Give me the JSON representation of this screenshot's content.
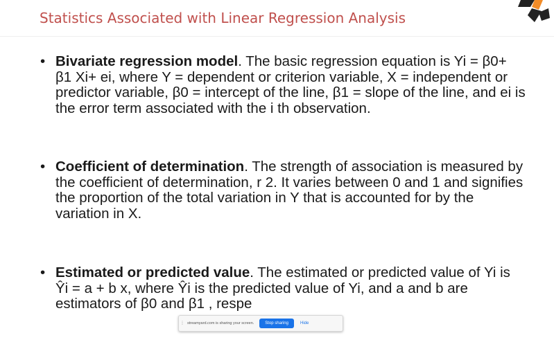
{
  "slide": {
    "title": "Statistics Associated with Linear Regression Analysis",
    "bullets": [
      {
        "heading": "Bivariate regression model",
        "body": ".  The basic regression equation is Yi = β0+ β1 Xi+ ei, where Y = dependent or criterion variable, X = independent or predictor variable, β0 = intercept of the line,  β1 = slope of the line, and ei is the error term associated with the i th observation."
      },
      {
        "heading": "Coefficient of determination",
        "body": ".  The strength of association is measured by the coefficient of determination, r 2.  It varies between 0 and 1 and signifies the proportion of the total variation in Y that is accounted for by the variation in X."
      },
      {
        "heading": "Estimated or predicted value",
        "body": ".  The estimated or predicted value of Yi is Ŷi = a + b x, where Ŷi is the predicted value of Yi, and a and b are estimators of β0 and β1 , respe"
      }
    ]
  },
  "share_banner": {
    "message": "streamyard.com is sharing your screen.",
    "stop_label": "Stop sharing",
    "hide_label": "Hide"
  },
  "colors": {
    "title": "#c0504d",
    "button": "#1a73e8",
    "logo": "#f28c28"
  }
}
